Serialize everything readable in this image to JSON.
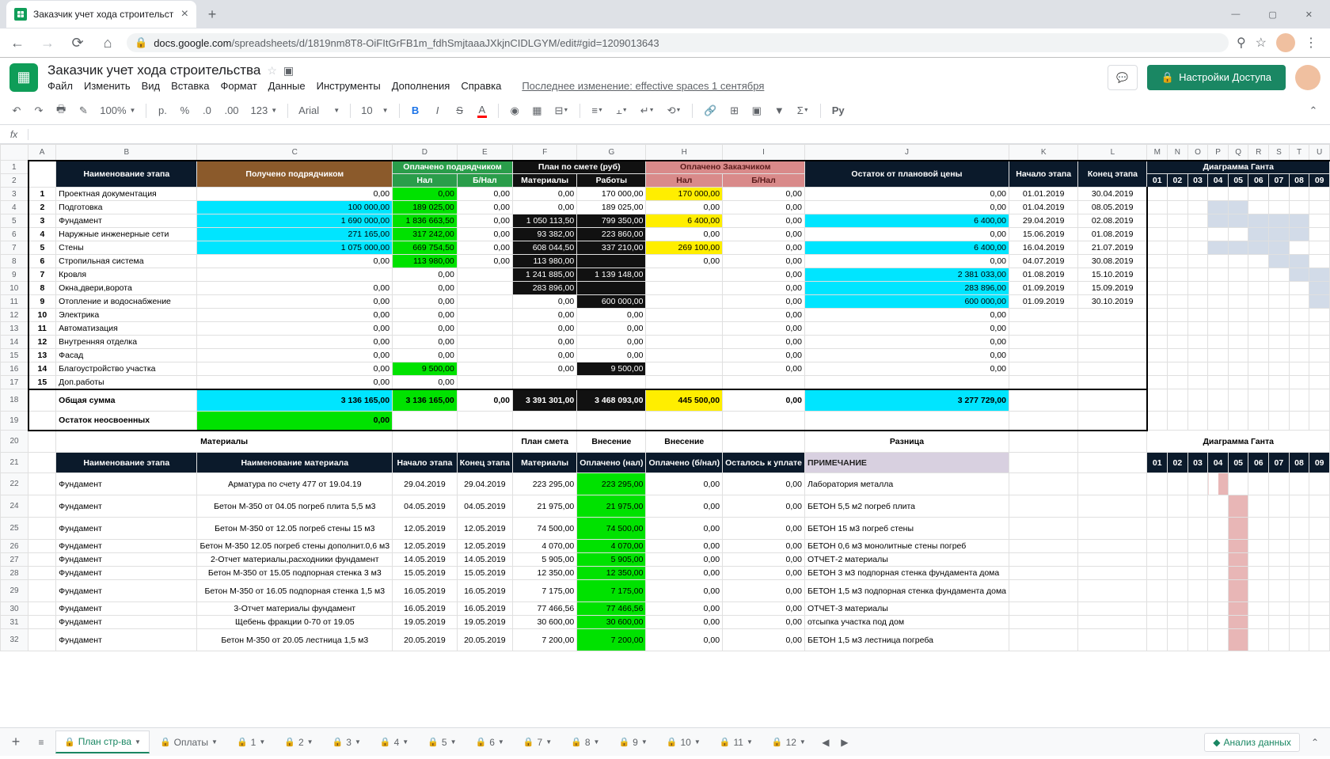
{
  "browser": {
    "tab_title": "Заказчик учет хода строительст",
    "url_host": "docs.google.com",
    "url_path": "/spreadsheets/d/1819nm8T8-OiFItGrFB1m_fdhSmjtaaaJXkjnCIDLGYM/edit#gid=1209013643"
  },
  "gs": {
    "title": "Заказчик учет хода строительства",
    "menu": [
      "Файл",
      "Изменить",
      "Вид",
      "Вставка",
      "Формат",
      "Данные",
      "Инструменты",
      "Дополнения",
      "Справка"
    ],
    "lastedit": "Последнее изменение: effective spaces 1 сентября",
    "share_label": "Настройки Доступа"
  },
  "toolbar": {
    "zoom": "100%",
    "font": "Arial",
    "size": "10",
    "more": "123"
  },
  "col_letters": [
    "A",
    "B",
    "C",
    "D",
    "E",
    "F",
    "G",
    "H",
    "I",
    "J",
    "K",
    "L",
    "M",
    "N",
    "O",
    "P",
    "Q",
    "R",
    "S",
    "T",
    "U"
  ],
  "block1": {
    "hdr": {
      "stage": "Наименование этапа",
      "received": "Получено подрядчиком",
      "paid_contractor": "Оплачено подрядчиком",
      "nal": "Нал",
      "bnal": "Б/Нал",
      "plan": "План по смете (руб)",
      "materials": "Материалы",
      "works": "Работы",
      "paid_customer": "Оплачено Заказчиком",
      "remainder": "Остаток от плановой цены",
      "start": "Начало этапа",
      "end": "Конец этапа",
      "gantt": "Диаграмма Ганта",
      "months": [
        "01",
        "02",
        "03",
        "04",
        "05",
        "06",
        "07",
        "08",
        "09"
      ]
    },
    "rows": [
      {
        "n": "1",
        "name": "Проектная документация",
        "c": "0,00",
        "d": "0,00",
        "e": "0,00",
        "f": "0,00",
        "g": "170 000,00",
        "h": "170 000,00",
        "i": "0,00",
        "j": "0,00",
        "k": "01.01.2019",
        "l": "30.04.2019",
        "cyan_c": false,
        "grn_d": true,
        "yel_h": true,
        "cyan_j": false,
        "gantt": [
          0,
          0,
          0,
          0,
          0,
          0,
          0,
          0,
          0
        ]
      },
      {
        "n": "2",
        "name": "Подготовка",
        "c": "100 000,00",
        "d": "189 025,00",
        "e": "0,00",
        "f": "0,00",
        "g": "189 025,00",
        "h": "0,00",
        "i": "0,00",
        "j": "0,00",
        "k": "01.04.2019",
        "l": "08.05.2019",
        "cyan_c": true,
        "grn_d": true,
        "yel_h": false,
        "cyan_j": false,
        "gantt": [
          0,
          0,
          0,
          1,
          1,
          0,
          0,
          0,
          0
        ]
      },
      {
        "n": "3",
        "name": "Фундамент",
        "c": "1 690 000,00",
        "d": "1 836 663,50",
        "e": "0,00",
        "f": "1 050 113,50",
        "g": "799 350,00",
        "h": "6 400,00",
        "i": "0,00",
        "j": "6 400,00",
        "k": "29.04.2019",
        "l": "02.08.2019",
        "cyan_c": true,
        "grn_d": true,
        "yel_h": true,
        "cyan_j": true,
        "blk_fg": true,
        "gantt": [
          0,
          0,
          0,
          1,
          1,
          1,
          1,
          1,
          0
        ]
      },
      {
        "n": "4",
        "name": "Наружные инженерные сети",
        "c": "271 165,00",
        "d": "317 242,00",
        "e": "0,00",
        "f": "93 382,00",
        "g": "223 860,00",
        "h": "0,00",
        "i": "0,00",
        "j": "0,00",
        "k": "15.06.2019",
        "l": "01.08.2019",
        "cyan_c": true,
        "grn_d": true,
        "yel_h": false,
        "cyan_j": false,
        "blk_fg": true,
        "gantt": [
          0,
          0,
          0,
          0,
          0,
          1,
          1,
          1,
          0
        ]
      },
      {
        "n": "5",
        "name": "Стены",
        "c": "1 075 000,00",
        "d": "669 754,50",
        "e": "0,00",
        "f": "608 044,50",
        "g": "337 210,00",
        "h": "269 100,00",
        "i": "0,00",
        "j": "6 400,00",
        "k": "16.04.2019",
        "l": "21.07.2019",
        "cyan_c": true,
        "grn_d": true,
        "yel_h": true,
        "cyan_j": true,
        "blk_fg": true,
        "gantt": [
          0,
          0,
          0,
          1,
          1,
          1,
          1,
          0,
          0
        ]
      },
      {
        "n": "6",
        "name": "Стропильная система",
        "c": "0,00",
        "d": "113 980,00",
        "e": "0,00",
        "f": "113 980,00",
        "g": "",
        "h": "0,00",
        "i": "0,00",
        "j": "0,00",
        "k": "04.07.2019",
        "l": "30.08.2019",
        "cyan_c": false,
        "grn_d": true,
        "yel_h": false,
        "cyan_j": false,
        "blk_fg": true,
        "gantt": [
          0,
          0,
          0,
          0,
          0,
          0,
          1,
          1,
          0
        ]
      },
      {
        "n": "7",
        "name": "Кровля",
        "c": "",
        "d": "0,00",
        "e": "",
        "f": "1 241 885,00",
        "g": "1 139 148,00",
        "h": "",
        "i": "0,00",
        "j": "2 381 033,00",
        "k": "01.08.2019",
        "l": "15.10.2019",
        "cyan_c": false,
        "grn_d": false,
        "yel_h": false,
        "cyan_j": true,
        "blk_fg": true,
        "gantt": [
          0,
          0,
          0,
          0,
          0,
          0,
          0,
          1,
          1
        ]
      },
      {
        "n": "8",
        "name": "Окна,двери,ворота",
        "c": "0,00",
        "d": "0,00",
        "e": "",
        "f": "283 896,00",
        "g": "",
        "h": "",
        "i": "0,00",
        "j": "283 896,00",
        "k": "01.09.2019",
        "l": "15.09.2019",
        "cyan_c": false,
        "grn_d": false,
        "yel_h": false,
        "cyan_j": true,
        "blk_fg": true,
        "gantt": [
          0,
          0,
          0,
          0,
          0,
          0,
          0,
          0,
          1
        ]
      },
      {
        "n": "9",
        "name": "Отопление и водоснабжение",
        "c": "0,00",
        "d": "0,00",
        "e": "",
        "f": "0,00",
        "g": "600 000,00",
        "h": "",
        "i": "0,00",
        "j": "600 000,00",
        "k": "01.09.2019",
        "l": "30.10.2019",
        "cyan_c": false,
        "grn_d": false,
        "yel_h": false,
        "cyan_j": true,
        "blk_g": true,
        "gantt": [
          0,
          0,
          0,
          0,
          0,
          0,
          0,
          0,
          1
        ]
      },
      {
        "n": "10",
        "name": "Электрика",
        "c": "0,00",
        "d": "0,00",
        "e": "",
        "f": "0,00",
        "g": "0,00",
        "h": "",
        "i": "0,00",
        "j": "0,00",
        "k": "",
        "l": "",
        "gantt": [
          0,
          0,
          0,
          0,
          0,
          0,
          0,
          0,
          0
        ]
      },
      {
        "n": "11",
        "name": "Автоматизация",
        "c": "0,00",
        "d": "0,00",
        "e": "",
        "f": "0,00",
        "g": "0,00",
        "h": "",
        "i": "0,00",
        "j": "0,00",
        "k": "",
        "l": "",
        "gantt": [
          0,
          0,
          0,
          0,
          0,
          0,
          0,
          0,
          0
        ]
      },
      {
        "n": "12",
        "name": "Внутренняя отделка",
        "c": "0,00",
        "d": "0,00",
        "e": "",
        "f": "0,00",
        "g": "0,00",
        "h": "",
        "i": "0,00",
        "j": "0,00",
        "k": "",
        "l": "",
        "gantt": [
          0,
          0,
          0,
          0,
          0,
          0,
          0,
          0,
          0
        ]
      },
      {
        "n": "13",
        "name": "Фасад",
        "c": "0,00",
        "d": "0,00",
        "e": "",
        "f": "0,00",
        "g": "0,00",
        "h": "",
        "i": "0,00",
        "j": "0,00",
        "k": "",
        "l": "",
        "gantt": [
          0,
          0,
          0,
          0,
          0,
          0,
          0,
          0,
          0
        ]
      },
      {
        "n": "14",
        "name": "Благоустройство участка",
        "c": "0,00",
        "d": "9 500,00",
        "e": "",
        "f": "0,00",
        "g": "9 500,00",
        "h": "",
        "i": "0,00",
        "j": "0,00",
        "k": "",
        "l": "",
        "grn_d": true,
        "blk_g": true,
        "gantt": [
          0,
          0,
          0,
          0,
          0,
          0,
          0,
          0,
          0
        ]
      },
      {
        "n": "15",
        "name": "Доп.работы",
        "c": "0,00",
        "d": "0,00",
        "e": "",
        "f": "",
        "g": "",
        "h": "",
        "i": "",
        "j": "",
        "k": "",
        "l": "",
        "gantt": [
          0,
          0,
          0,
          0,
          0,
          0,
          0,
          0,
          0
        ]
      }
    ],
    "sum": {
      "label": "Общая сумма",
      "c": "3 136 165,00",
      "d": "3 136 165,00",
      "e": "0,00",
      "f": "3 391 301,00",
      "g": "3 468 093,00",
      "h": "445 500,00",
      "i": "0,00",
      "j": "3 277 729,00"
    },
    "rest": {
      "label": "Остаток неосвоенных",
      "c": "0,00"
    }
  },
  "block2_hdr_row": {
    "materials": "Материалы",
    "plan": "План смета",
    "vnes1": "Внесение",
    "vnes2": "Внесение",
    "diff": "Разница",
    "gantt": "Диаграмма Ганта"
  },
  "block2": {
    "hdr": {
      "stage": "Наименование этапа",
      "mat": "Наименование материала",
      "start": "Начало этапа",
      "end": "Конец этапа",
      "mats": "Материалы",
      "paid_nal": "Оплачено (нал)",
      "paid_bnal": "Оплачено (б/нал)",
      "remain": "Осталось к уплате",
      "note": "ПРИМЕЧАНИЕ",
      "months": [
        "01",
        "02",
        "03",
        "04",
        "05",
        "06",
        "07",
        "08",
        "09"
      ]
    },
    "rows": [
      {
        "a": "Фундамент",
        "b": "Арматура по счету 477 от 19.04.19",
        "s": "29.04.2019",
        "e": "29.04.2019",
        "m": "223 295,00",
        "pn": "223 295,00",
        "pb": "0,00",
        "r": "0,00",
        "note": "Лаборатория металла",
        "gm": 4,
        "gs": 1
      },
      {
        "a": "Фундамент",
        "b": "Бетон М-350 от 04.05 погреб плита 5,5 м3",
        "s": "04.05.2019",
        "e": "04.05.2019",
        "m": "21 975,00",
        "pn": "21 975,00",
        "pb": "0,00",
        "r": "0,00",
        "note": "БЕТОН 5,5 м2 погреб плита",
        "gm": 5,
        "gs": 0
      },
      {
        "a": "Фундамент",
        "b": "Бетон М-350 от 12.05 погреб стены 15 м3",
        "s": "12.05.2019",
        "e": "12.05.2019",
        "m": "74 500,00",
        "pn": "74 500,00",
        "pb": "0,00",
        "r": "0,00",
        "note": "БЕТОН 15 м3 погреб стены",
        "gm": 5,
        "gs": 0
      },
      {
        "a": "Фундамент",
        "b": "Бетон М-350 12.05 погреб стены дополнит.0,6 м3",
        "s": "12.05.2019",
        "e": "12.05.2019",
        "m": "4 070,00",
        "pn": "4 070,00",
        "pb": "0,00",
        "r": "0,00",
        "note": "БЕТОН 0,6 м3 монолитные стены погреб",
        "gm": 5,
        "gs": 0
      },
      {
        "a": "Фундамент",
        "b": "2-Отчет материалы,расходники фундамент",
        "s": "14.05.2019",
        "e": "14.05.2019",
        "m": "5 905,00",
        "pn": "5 905,00",
        "pb": "0,00",
        "r": "0,00",
        "note": "ОТЧЕТ-2 материалы",
        "gm": 5,
        "gs": 0
      },
      {
        "a": "Фундамент",
        "b": "Бетон М-350 от 15.05 подпорная стенка 3 м3",
        "s": "15.05.2019",
        "e": "15.05.2019",
        "m": "12 350,00",
        "pn": "12 350,00",
        "pb": "0,00",
        "r": "0,00",
        "note": "БЕТОН 3 м3 подпорная стенка фундамента дома",
        "gm": 5,
        "gs": 0
      },
      {
        "a": "Фундамент",
        "b": "Бетон М-350 от 16.05 подпорная стенка 1,5 м3",
        "s": "16.05.2019",
        "e": "16.05.2019",
        "m": "7 175,00",
        "pn": "7 175,00",
        "pb": "0,00",
        "r": "0,00",
        "note": "БЕТОН 1,5 м3 подпорная стенка фундамента дома",
        "gm": 5,
        "gs": 0
      },
      {
        "a": "Фундамент",
        "b": "3-Отчет материалы фундамент",
        "s": "16.05.2019",
        "e": "16.05.2019",
        "m": "77 466,56",
        "pn": "77 466,56",
        "pb": "0,00",
        "r": "0,00",
        "note": "ОТЧЕТ-3 материалы",
        "gm": 5,
        "gs": 0
      },
      {
        "a": "Фундамент",
        "b": "Щебень фракции 0-70 от 19.05",
        "s": "19.05.2019",
        "e": "19.05.2019",
        "m": "30 600,00",
        "pn": "30 600,00",
        "pb": "0,00",
        "r": "0,00",
        "note": "отсыпка участка под дом",
        "gm": 5,
        "gs": 0
      },
      {
        "a": "Фундамент",
        "b": "Бетон М-350 от 20.05 лестница 1,5 м3",
        "s": "20.05.2019",
        "e": "20.05.2019",
        "m": "7 200,00",
        "pn": "7 200,00",
        "pb": "0,00",
        "r": "0,00",
        "note": "БЕТОН 1,5 м3 лестница погреба",
        "gm": 5,
        "gs": 0
      }
    ]
  },
  "sheet_tabs": [
    {
      "label": "План стр-ва",
      "lock": true,
      "active": true
    },
    {
      "label": "Оплаты",
      "lock": true
    },
    {
      "label": "1",
      "lock": true
    },
    {
      "label": "2",
      "lock": true
    },
    {
      "label": "3",
      "lock": true
    },
    {
      "label": "4",
      "lock": true
    },
    {
      "label": "5",
      "lock": true
    },
    {
      "label": "6",
      "lock": true
    },
    {
      "label": "7",
      "lock": true
    },
    {
      "label": "8",
      "lock": true
    },
    {
      "label": "9",
      "lock": true
    },
    {
      "label": "10",
      "lock": true
    },
    {
      "label": "11",
      "lock": true
    },
    {
      "label": "12",
      "lock": true
    }
  ],
  "analyze_label": "Анализ данных"
}
